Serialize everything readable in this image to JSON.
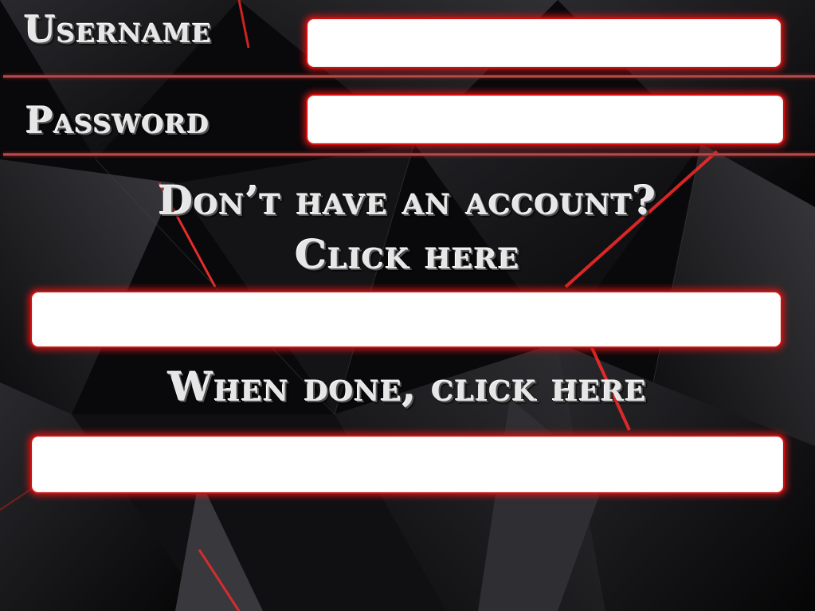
{
  "login": {
    "username_label": "Username",
    "password_label": "Password",
    "username_value": "",
    "password_value": ""
  },
  "signup": {
    "prompt_line1": "Don’t have an account?",
    "prompt_line2": "Click here"
  },
  "done": {
    "prompt": "When done, click here"
  },
  "colors": {
    "accent": "#d01010",
    "background": "#0a0a0c",
    "label_text": "#e6e6e6"
  }
}
